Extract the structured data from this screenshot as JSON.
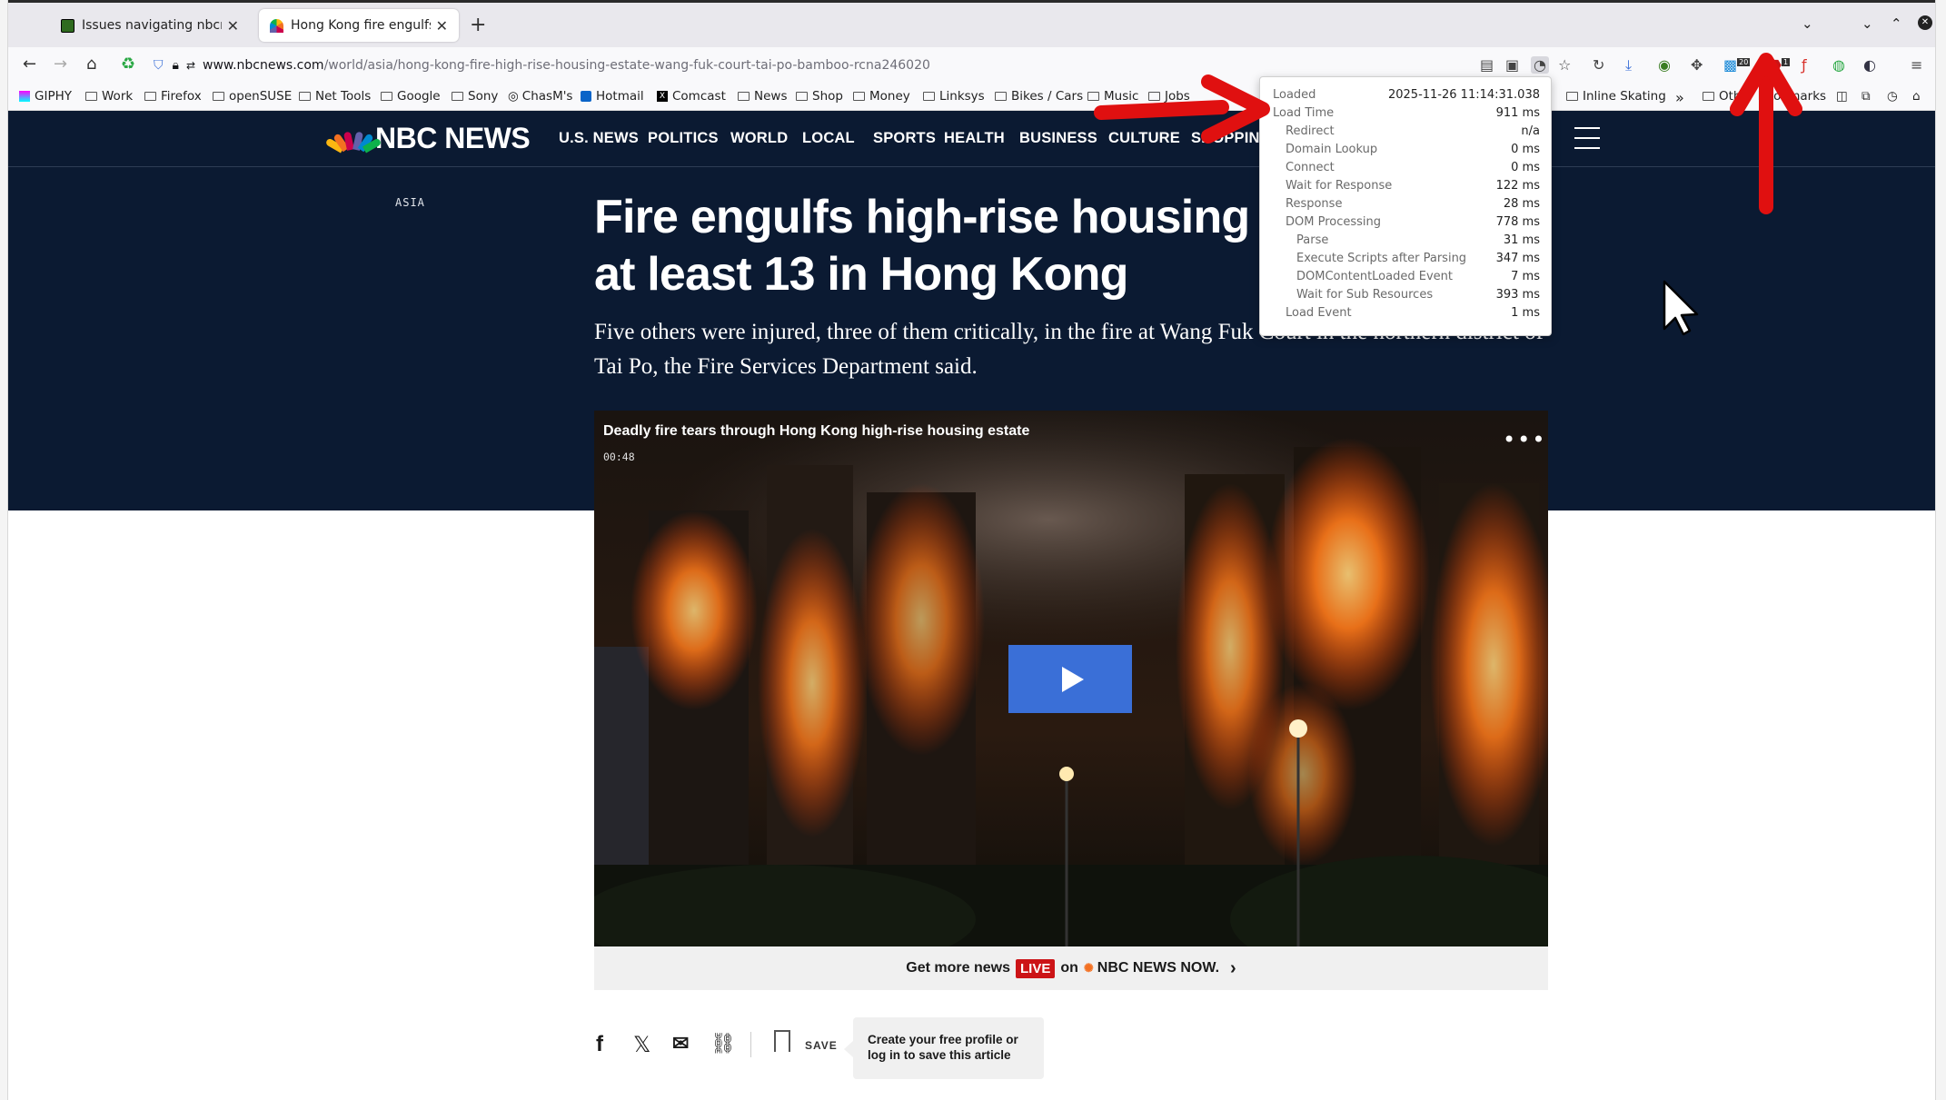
{
  "browser": {
    "tabs": [
      {
        "title": "Issues navigating nbcnews.",
        "favicon_color": "#2f6b1f",
        "active": false
      },
      {
        "title": "Hong Kong fire engulfs hig",
        "favicon_color": "#ffffff",
        "active": true
      }
    ],
    "new_tab_label": "+",
    "url_host": "www.nbcnews.com",
    "url_path": "/world/asia/hong-kong-fire-high-rise-housing-estate-wang-fuk-court-tai-po-bamboo-rcna246020",
    "badge_counts": [
      "20",
      "1"
    ],
    "bookmarks": [
      "GIPHY",
      "Work",
      "Firefox",
      "openSUSE",
      "Net Tools",
      "Google",
      "Sony",
      "ChasM's",
      "Hotmail",
      "Comcast",
      "News",
      "Shop",
      "Money",
      "Linksys",
      "Bikes / Cars",
      "Music",
      "Jobs",
      "Inline Skating",
      "Other Bookmarks"
    ],
    "bookmarks_overflow": "»"
  },
  "site": {
    "logo_text": "NBC NEWS",
    "nav": [
      "U.S. NEWS",
      "POLITICS",
      "WORLD",
      "LOCAL",
      "SPORTS",
      "HEALTH",
      "BUSINESS",
      "CULTURE",
      "SHOPPING"
    ],
    "brand_colors": {
      "navy": "#0b1a32",
      "play": "#3a6fd7",
      "live": "#cc1417"
    }
  },
  "article": {
    "section": "ASIA",
    "headline": "Fire engulfs high-rise housing estate, killing at least 13 in Hong Kong",
    "dek": "Five others were injured, three of them critically, in the fire at Wang Fuk Court in the northern district of Tai Po, the Fire Services Department said.",
    "video": {
      "title": "Deadly fire tears through Hong Kong high-rise housing estate",
      "duration": "00:48",
      "more": "•••"
    },
    "live_bar": {
      "prefix": "Get more news",
      "badge": "LIVE",
      "on": "on",
      "brand": "NBC NEWS NOW."
    },
    "share": {
      "save_label": "SAVE",
      "profile_tip": "Create your free profile or log in to save this article"
    }
  },
  "timing_popup": {
    "rows": [
      {
        "label": "Loaded",
        "value": "2025-11-26 11:14:31.038",
        "indent": 0
      },
      {
        "label": "Load Time",
        "value": "911 ms",
        "indent": 0
      },
      {
        "label": "Redirect",
        "value": "n/a",
        "indent": 1
      },
      {
        "label": "Domain Lookup",
        "value": "0 ms",
        "indent": 1
      },
      {
        "label": "Connect",
        "value": "0 ms",
        "indent": 1
      },
      {
        "label": "Wait for Response",
        "value": "122 ms",
        "indent": 1
      },
      {
        "label": "Response",
        "value": "28 ms",
        "indent": 1
      },
      {
        "label": "DOM Processing",
        "value": "778 ms",
        "indent": 1
      },
      {
        "label": "Parse",
        "value": "31 ms",
        "indent": 2
      },
      {
        "label": "Execute Scripts after Parsing",
        "value": "347 ms",
        "indent": 2
      },
      {
        "label": "DOMContentLoaded Event",
        "value": "7 ms",
        "indent": 2
      },
      {
        "label": "Wait for Sub Resources",
        "value": "393 ms",
        "indent": 2
      },
      {
        "label": "Load Event",
        "value": "1 ms",
        "indent": 1
      }
    ]
  }
}
